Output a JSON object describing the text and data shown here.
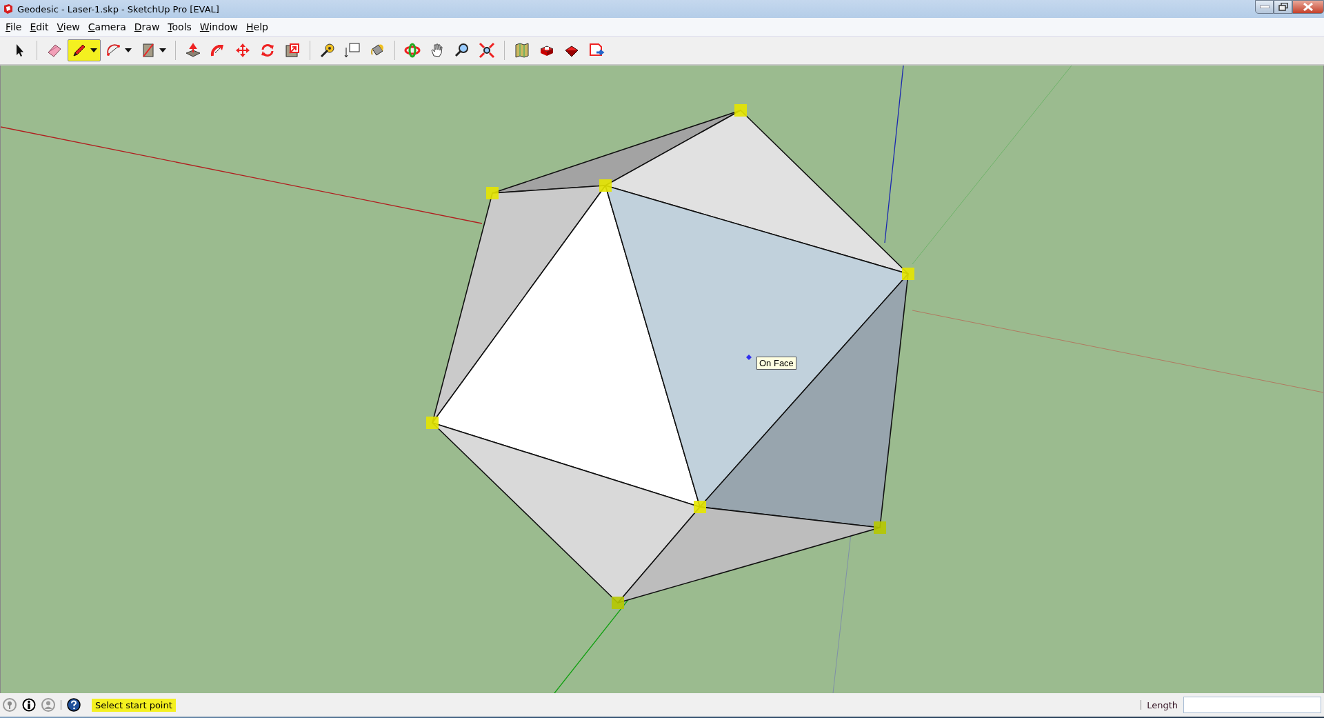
{
  "window": {
    "title": "Geodesic - Laser-1.skp - SketchUp Pro [EVAL]"
  },
  "menu": [
    "File",
    "Edit",
    "View",
    "Camera",
    "Draw",
    "Tools",
    "Window",
    "Help"
  ],
  "toolbar": {
    "groups": [
      [
        {
          "selected": false,
          "dropdown": false
        }
      ],
      [
        {
          "selected": false,
          "dropdown": false
        },
        {
          "selected": true,
          "dropdown": true
        },
        {
          "selected": false,
          "dropdown": true
        },
        {
          "selected": false,
          "dropdown": true
        }
      ],
      [
        {
          "selected": false,
          "dropdown": false
        },
        {
          "selected": false,
          "dropdown": false
        },
        {
          "selected": false,
          "dropdown": false
        },
        {
          "selected": false,
          "dropdown": false
        },
        {
          "selected": false,
          "dropdown": false
        }
      ],
      [
        {
          "selected": false,
          "dropdown": false
        },
        {
          "selected": false,
          "dropdown": false
        },
        {
          "selected": false,
          "dropdown": false
        }
      ],
      [
        {
          "selected": false,
          "dropdown": false
        },
        {
          "selected": false,
          "dropdown": false
        },
        {
          "selected": false,
          "dropdown": false
        },
        {
          "selected": false,
          "dropdown": false
        }
      ],
      [
        {
          "selected": false,
          "dropdown": false
        },
        {
          "selected": false,
          "dropdown": false
        },
        {
          "selected": false,
          "dropdown": false
        },
        {
          "selected": false,
          "dropdown": false
        }
      ]
    ]
  },
  "viewport": {
    "tooltip": "On Face"
  },
  "status_bar": {
    "hint": "Select start point",
    "measurement_label": "Length"
  }
}
